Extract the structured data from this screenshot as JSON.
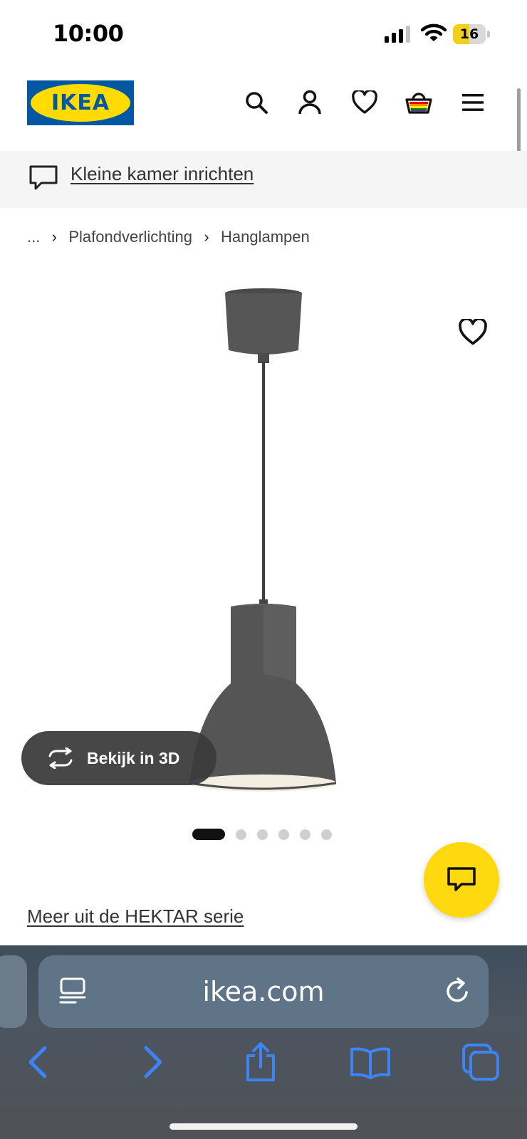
{
  "status_bar": {
    "time": "10:00",
    "battery_level": "16",
    "icons": [
      "signal-icon",
      "wifi-icon",
      "battery-icon"
    ]
  },
  "header": {
    "logo_text": "IKEA",
    "icons": [
      "search-icon",
      "account-icon",
      "wishlist-icon",
      "cart-icon",
      "menu-icon"
    ]
  },
  "banner": {
    "link_text": "Kleine kamer inrichten",
    "icon": "speech-bubble-icon"
  },
  "breadcrumb": {
    "items": [
      "...",
      "Plafondverlichting",
      "Hanglampen"
    ]
  },
  "product": {
    "image": "pendant-lamp-image",
    "favorite_icon": "heart-icon",
    "view_3d_label": "Bekijk in 3D",
    "carousel": {
      "total": 6,
      "active": 1
    },
    "series_link": "Meer uit de HEKTAR serie"
  },
  "chat": {
    "icon": "chat-icon"
  },
  "browser": {
    "address": "ikea.com",
    "toolbar_icons": [
      "back-icon",
      "forward-icon",
      "share-icon",
      "bookmarks-icon",
      "tabs-icon"
    ]
  },
  "colors": {
    "brand_blue": "#0058a3",
    "brand_yellow": "#ffdb00",
    "chat_yellow": "#ffd90f",
    "browser_blue": "#3d84f5"
  }
}
